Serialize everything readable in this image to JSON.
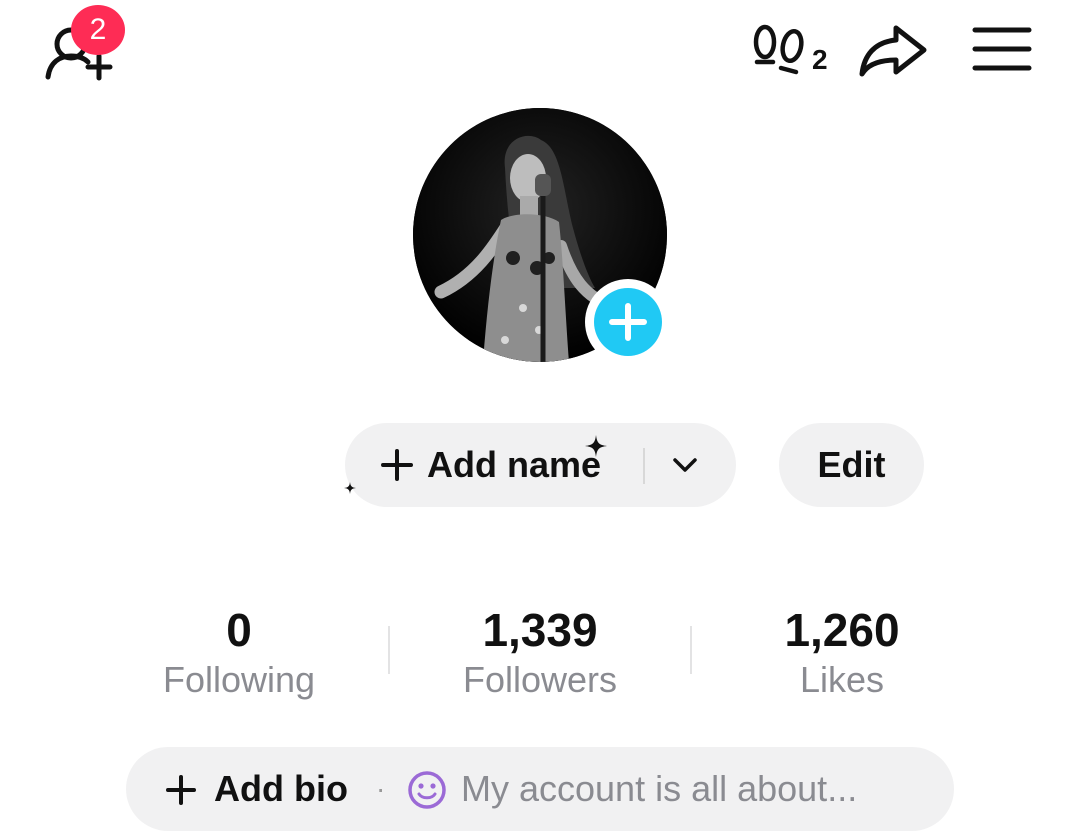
{
  "header": {
    "friend_requests_count": "2",
    "profile_views_count": "2"
  },
  "profile": {
    "add_name_label": "Add name",
    "edit_label": "Edit"
  },
  "stats": [
    {
      "value": "0",
      "label": "Following"
    },
    {
      "value": "1,339",
      "label": "Followers"
    },
    {
      "value": "1,260",
      "label": "Likes"
    }
  ],
  "bio": {
    "add_label": "Add bio",
    "separator": "·",
    "placeholder": "My account is all about..."
  },
  "colors": {
    "badge": "#fe2c55",
    "add_avatar": "#20c9f4",
    "emoji_purple": "#9b6ad6"
  },
  "icons": [
    "add-friend-icon",
    "footprint-icon",
    "share-icon",
    "menu-icon",
    "plus-icon",
    "chevron-down-icon",
    "smile-icon",
    "sparkle-icon"
  ]
}
